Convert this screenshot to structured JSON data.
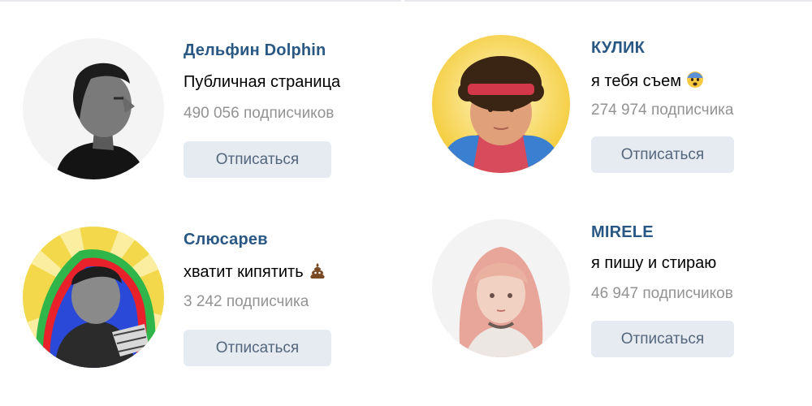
{
  "communities": [
    {
      "name": "Дельфин Dolphin",
      "status": "Публичная страница",
      "subscribers": "490 056 подписчиков",
      "button_label": "Отписаться",
      "avatar": "bw-portrait-man-profile"
    },
    {
      "name": "КУЛИК",
      "status": "я тебя съем",
      "status_emoji": "fearful-face-emoji",
      "subscribers": "274 974 подписчика",
      "button_label": "Отписаться",
      "avatar": "portrait-man-red-headband-yellow-background"
    },
    {
      "name": "Слюсарев",
      "status": "хватит кипятить",
      "status_emoji": "pile-of-poo-emoji",
      "subscribers": "3 242 подписчика",
      "button_label": "Отписаться",
      "avatar": "bw-man-colorful-rays-background"
    },
    {
      "name": "MIRELE",
      "status": "я пишу и стираю",
      "subscribers": "46 947 подписчиков",
      "button_label": "Отписаться",
      "avatar": "portrait-woman-pink-hair"
    }
  ],
  "colors": {
    "link": "#2a5885",
    "muted": "#939393",
    "button_bg": "#e5ebf1",
    "button_text": "#55677d"
  }
}
